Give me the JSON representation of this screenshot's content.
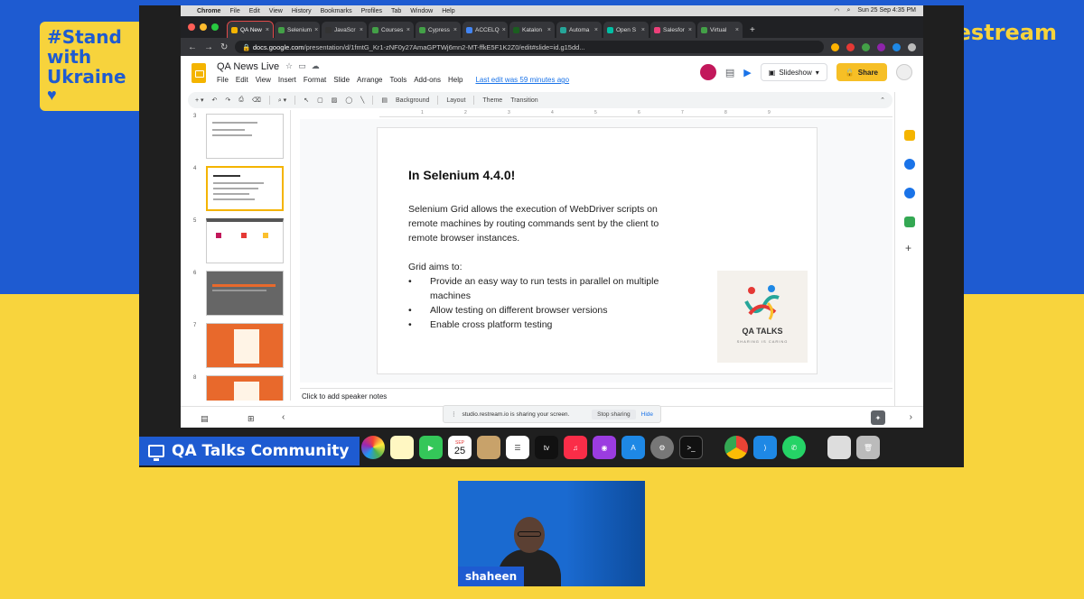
{
  "overlay": {
    "badge_line1": "#Stand",
    "badge_line2": "with",
    "badge_line3": "Ukraine",
    "brand": "Restream",
    "community_label": "QA Talks Community",
    "participant_name": "shaheen",
    "colors": {
      "blue": "#1e5bd1",
      "yellow": "#f7d33c"
    }
  },
  "menubar": {
    "app": "Chrome",
    "items": [
      "File",
      "Edit",
      "View",
      "History",
      "Bookmarks",
      "Profiles",
      "Tab",
      "Window",
      "Help"
    ],
    "clock": "Sun 25 Sep  4:35 PM"
  },
  "browser": {
    "tabs": [
      {
        "label": "QA New",
        "active": true
      },
      {
        "label": "Selenium"
      },
      {
        "label": "JavaScr"
      },
      {
        "label": "Courses"
      },
      {
        "label": "Cypress"
      },
      {
        "label": "ACCELQ"
      },
      {
        "label": "Katalon"
      },
      {
        "label": "Automa"
      },
      {
        "label": "Open S"
      },
      {
        "label": "Salesfor"
      },
      {
        "label": "Virtual"
      }
    ],
    "url_host": "docs.google.com",
    "url_path": "/presentation/d/1fmtG_Kr1-zNF0y27AmaGPTWj6mn2-MT-ffkE5F1K2Z0/edit#slide=id.g15dd..."
  },
  "slides": {
    "doc_title": "QA News Live",
    "menu": [
      "File",
      "Edit",
      "View",
      "Insert",
      "Format",
      "Slide",
      "Arrange",
      "Tools",
      "Add-ons",
      "Help"
    ],
    "last_edit": "Last edit was 59 minutes ago",
    "slideshow_label": "Slideshow",
    "share_label": "Share",
    "toolbar": {
      "background": "Background",
      "layout": "Layout",
      "theme": "Theme",
      "transition": "Transition"
    },
    "ruler_ticks": [
      "1",
      "2",
      "3",
      "4",
      "5",
      "6",
      "7",
      "8",
      "9"
    ],
    "thumb_numbers": [
      "3",
      "4",
      "5",
      "6",
      "7",
      "8"
    ],
    "current_slide": {
      "title": "In Selenium 4.4.0!",
      "para1": "Selenium Grid allows the execution of WebDriver scripts on remote machines by routing commands sent by the client to remote browser instances.",
      "aims_heading": "Grid aims to:",
      "bullets": [
        "Provide an easy way to run tests in parallel on multiple machines",
        "Allow testing on different browser versions",
        "Enable cross platform testing"
      ],
      "logo_text": "QA TALKS",
      "logo_sub": "SHARING IS CARING"
    },
    "speaker_notes_placeholder": "Click to add speaker notes"
  },
  "sharing_bar": {
    "message": "studio.restream.io is sharing your screen.",
    "stop": "Stop sharing",
    "hide": "Hide"
  },
  "dock": {
    "calendar_month": "SEP",
    "calendar_day": "25"
  }
}
